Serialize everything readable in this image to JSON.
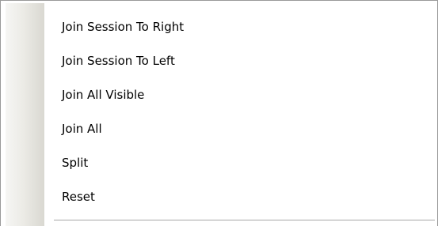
{
  "context_menu": {
    "items": [
      {
        "label": "Join Session To Right"
      },
      {
        "label": "Join Session To Left"
      },
      {
        "label": "Join All Visible"
      },
      {
        "label": "Join All"
      },
      {
        "label": "Split"
      },
      {
        "label": "Reset"
      }
    ]
  }
}
